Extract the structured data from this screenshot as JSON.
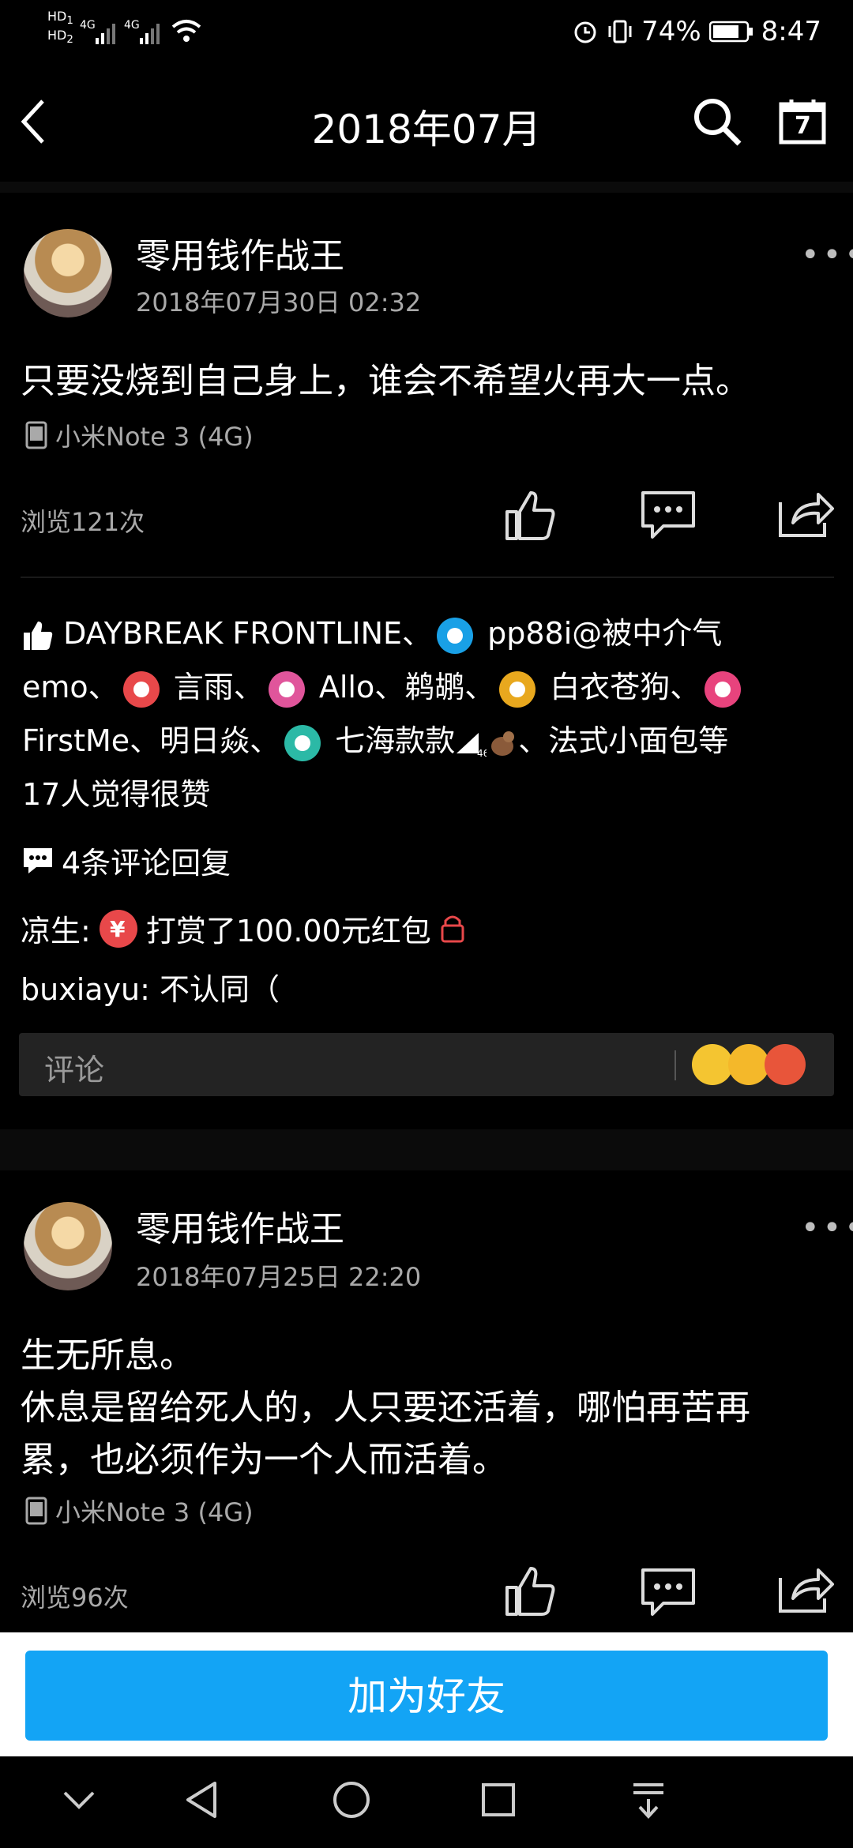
{
  "status_bar": {
    "network_left": "HD 1  4G  4G",
    "battery": "74%",
    "time": "8:47"
  },
  "nav": {
    "title": "2018年07月",
    "back_icon": "back-icon",
    "search_icon": "search-icon",
    "calendar_icon": "calendar-icon",
    "calendar_day": "7"
  },
  "posts": [
    {
      "author": "零用钱作战王",
      "time": "2018年07月30日 02:32",
      "text": "只要没烧到自己身上，谁会不希望火再大一点。",
      "device": "小米Note 3 (4G)",
      "views": "浏览121次",
      "likes_line1": " DAYBREAK FRONTLINE、",
      "likes_u1": " pp88i@被中介气",
      "likes_line2a": "emo、",
      "likes_u2": " 言雨、",
      "likes_u3": " Allo、鹈鹕、",
      "likes_u4": " 白衣苍狗、",
      "likes_line3a": "FirstMe、明日焱、",
      "likes_u5": " 七海款款",
      "likes_line3b": "、法式小面包等",
      "likes_line4": "17人觉得很赞",
      "comment_count": "4条评论回复",
      "comments": [
        {
          "user": "凉生:",
          "text": "打赏了100.00元红包"
        },
        {
          "user": "buxiayu:",
          "text": "不认同（"
        }
      ],
      "comment_placeholder": "评论"
    },
    {
      "author": "零用钱作战王",
      "time": "2018年07月25日 22:20",
      "text_line1": "生无所息。",
      "text_line2": "休息是留给死人的，人只要还活着，哪怕再苦再",
      "text_line3": "累，也必须作为一个人而活着。",
      "device": "小米Note 3 (4G)",
      "views": "浏览96次"
    }
  ],
  "add_friend": "加为好友",
  "colors": {
    "accent": "#13a4f5",
    "background": "#000000",
    "muted": "#a9a9a9"
  }
}
